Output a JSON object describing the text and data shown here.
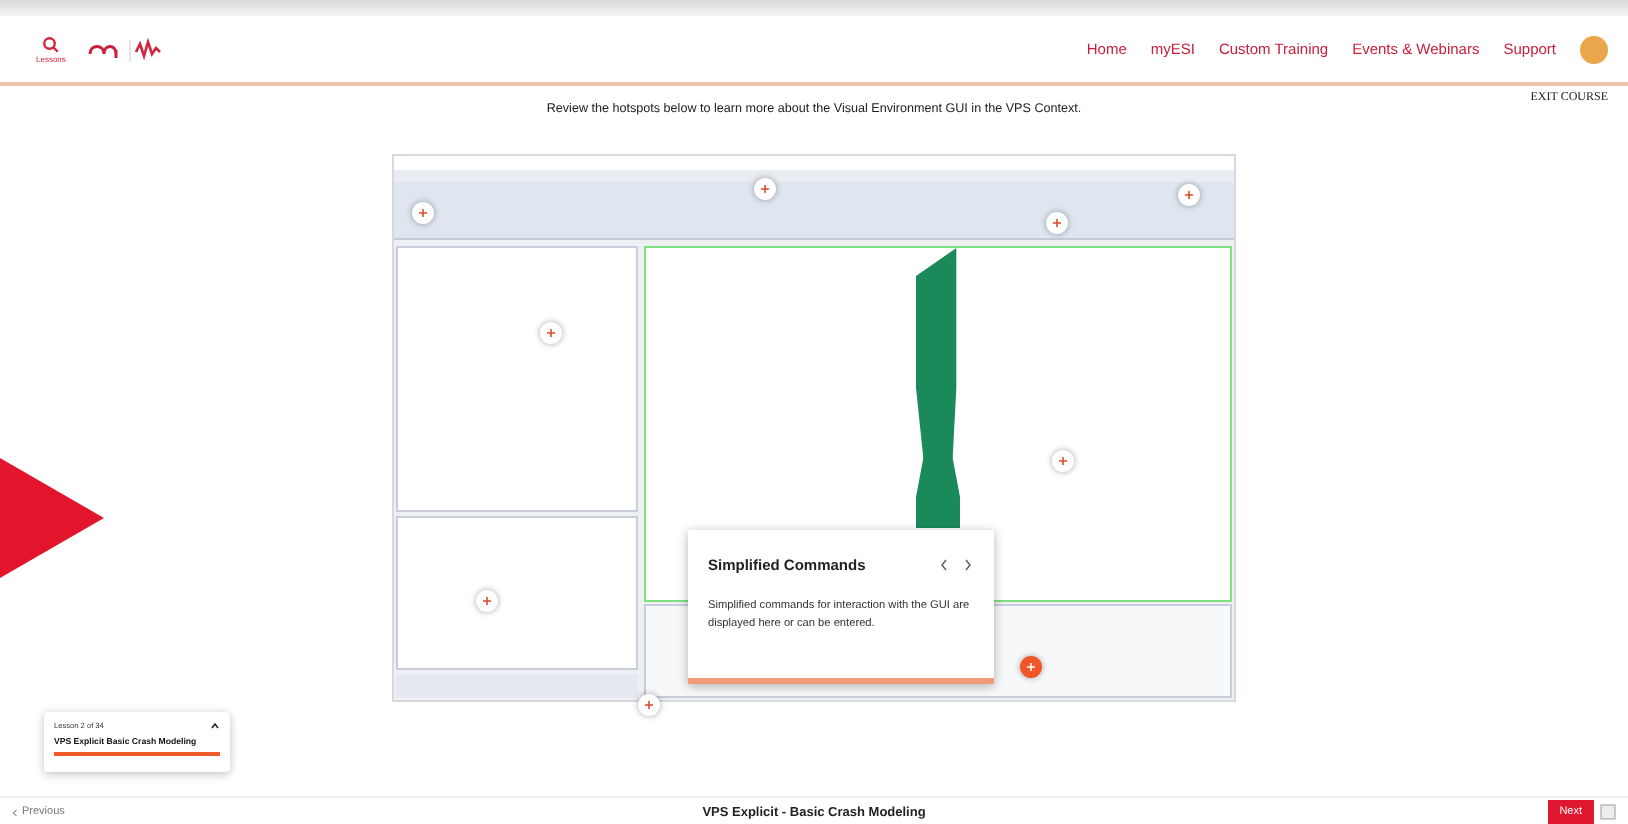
{
  "header": {
    "search_label": "Lessons",
    "nav": [
      {
        "label": "Home"
      },
      {
        "label": "myESI"
      },
      {
        "label": "Custom Training"
      },
      {
        "label": "Events & Webinars"
      },
      {
        "label": "Support"
      }
    ]
  },
  "exit": "EXIT COURSE",
  "intro": "Review the hotspots below to learn more about the Visual Environment GUI in the VPS Context.",
  "hotspots": [
    {
      "active": false
    },
    {
      "active": false
    },
    {
      "active": false
    },
    {
      "active": false
    },
    {
      "active": false
    },
    {
      "active": false
    },
    {
      "active": false
    },
    {
      "active": true
    },
    {
      "active": false
    }
  ],
  "popup": {
    "title": "Simplified Commands",
    "text": "Simplified commands for interaction with the GUI are displayed here or can be entered."
  },
  "lesson_card": {
    "counter": "Lesson 2 of 34",
    "title": "VPS Explicit Basic Crash Modeling",
    "level": 1
  },
  "footer": {
    "previous": "Previous",
    "title": "VPS Explicit - Basic Crash Modeling",
    "next": "Next"
  }
}
